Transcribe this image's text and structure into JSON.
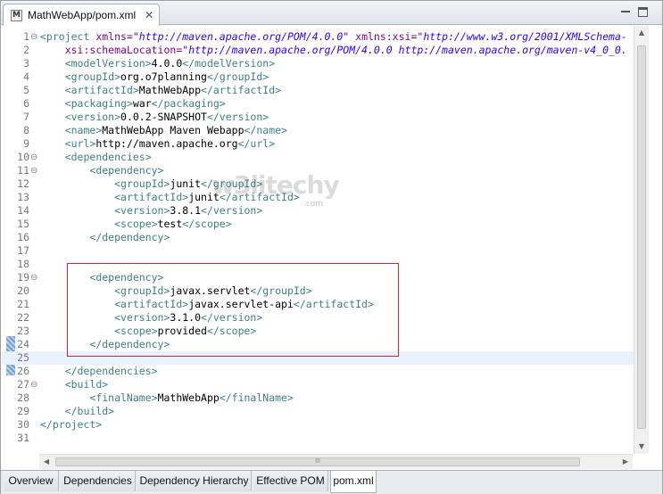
{
  "editor_tab": {
    "icon_letter": "M",
    "title": "MathWebApp/pom.xml",
    "close": "✕"
  },
  "lines": [
    {
      "n": "1",
      "fold": "⊖",
      "html": "<span class=\"t\">&lt;project</span> <span class=\"an\">xmlns=</span><span class=\"av\">\"http://maven.apache.org/POM/4.0.0\"</span> <span class=\"an\">xmlns:xsi=</span><span class=\"av\">\"http://www.w3.org/2001/XMLSchema-</span>"
    },
    {
      "n": "2",
      "html": "    <span class=\"an\">xsi:schemaLocation=</span><span class=\"av\">\"http://maven.apache.org/POM/4.0.0 http://maven.apache.org/maven-v4_0_0.</span>"
    },
    {
      "n": "3",
      "html": "    <span class=\"t\">&lt;modelVersion&gt;</span><span class=\"tx\">4.0.0</span><span class=\"t\">&lt;/modelVersion&gt;</span>"
    },
    {
      "n": "4",
      "html": "    <span class=\"t\">&lt;groupId&gt;</span><span class=\"tx\">org.o7planning</span><span class=\"t\">&lt;/groupId&gt;</span>"
    },
    {
      "n": "5",
      "html": "    <span class=\"t\">&lt;artifactId&gt;</span><span class=\"tx\">MathWebApp</span><span class=\"t\">&lt;/artifactId&gt;</span>"
    },
    {
      "n": "6",
      "html": "    <span class=\"t\">&lt;packaging&gt;</span><span class=\"tx\">war</span><span class=\"t\">&lt;/packaging&gt;</span>"
    },
    {
      "n": "7",
      "html": "    <span class=\"t\">&lt;version&gt;</span><span class=\"tx\">0.0.2-SNAPSHOT</span><span class=\"t\">&lt;/version&gt;</span>"
    },
    {
      "n": "8",
      "html": "    <span class=\"t\">&lt;name&gt;</span><span class=\"tx\">MathWebApp Maven Webapp</span><span class=\"t\">&lt;/name&gt;</span>"
    },
    {
      "n": "9",
      "html": "    <span class=\"t\">&lt;url&gt;</span><span class=\"tx\">http://maven.apache.org</span><span class=\"t\">&lt;/url&gt;</span>"
    },
    {
      "n": "10",
      "fold": "⊖",
      "html": "    <span class=\"t\">&lt;dependencies&gt;</span>"
    },
    {
      "n": "11",
      "fold": "⊖",
      "html": "        <span class=\"t\">&lt;dependency&gt;</span>"
    },
    {
      "n": "12",
      "html": "            <span class=\"t\">&lt;groupId&gt;</span><span class=\"tx\">junit</span><span class=\"t\">&lt;/groupId&gt;</span>"
    },
    {
      "n": "13",
      "html": "            <span class=\"t\">&lt;artifactId&gt;</span><span class=\"tx\">junit</span><span class=\"t\">&lt;/artifactId&gt;</span>"
    },
    {
      "n": "14",
      "html": "            <span class=\"t\">&lt;version&gt;</span><span class=\"tx\">3.8.1</span><span class=\"t\">&lt;/version&gt;</span>"
    },
    {
      "n": "15",
      "html": "            <span class=\"t\">&lt;scope&gt;</span><span class=\"tx\">test</span><span class=\"t\">&lt;/scope&gt;</span>"
    },
    {
      "n": "16",
      "html": "        <span class=\"t\">&lt;/dependency&gt;</span>"
    },
    {
      "n": "17",
      "html": ""
    },
    {
      "n": "18",
      "html": ""
    },
    {
      "n": "19",
      "fold": "⊖",
      "html": "        <span class=\"t\">&lt;dependency&gt;</span>"
    },
    {
      "n": "20",
      "html": "            <span class=\"t\">&lt;groupId&gt;</span><span class=\"tx\">javax.servlet</span><span class=\"t\">&lt;/groupId&gt;</span>"
    },
    {
      "n": "21",
      "html": "            <span class=\"t\">&lt;artifactId&gt;</span><span class=\"tx\">javax.servlet-api</span><span class=\"t\">&lt;/artifactId&gt;</span>"
    },
    {
      "n": "22",
      "html": "            <span class=\"t\">&lt;version&gt;</span><span class=\"tx\">3.1.0</span><span class=\"t\">&lt;/version&gt;</span>"
    },
    {
      "n": "23",
      "html": "            <span class=\"t\">&lt;scope&gt;</span><span class=\"tx\">provided</span><span class=\"t\">&lt;/scope&gt;</span>"
    },
    {
      "n": "24",
      "html": "        <span class=\"t\">&lt;/dependency&gt;</span>"
    },
    {
      "n": "25",
      "current": true,
      "html": ""
    },
    {
      "n": "26",
      "html": "    <span class=\"t\">&lt;/dependencies&gt;</span>"
    },
    {
      "n": "27",
      "fold": "⊖",
      "html": "    <span class=\"t\">&lt;build&gt;</span>"
    },
    {
      "n": "28",
      "html": "        <span class=\"t\">&lt;finalName&gt;</span><span class=\"tx\">MathWebApp</span><span class=\"t\">&lt;/finalName&gt;</span>"
    },
    {
      "n": "29",
      "html": "    <span class=\"t\">&lt;/build&gt;</span>"
    },
    {
      "n": "30",
      "html": "<span class=\"t\">&lt;/project&gt;</span>"
    },
    {
      "n": "31",
      "html": ""
    }
  ],
  "watermark": {
    "text": "w3litechy",
    "sub": ".com"
  },
  "scroll": {
    "up": "▲",
    "down": "▼",
    "left": "◀",
    "right": "▶",
    "grip": "III"
  },
  "page_tabs": [
    {
      "label": "Overview"
    },
    {
      "label": "Dependencies"
    },
    {
      "label": "Dependency Hierarchy"
    },
    {
      "label": "Effective POM"
    },
    {
      "label": "pom.xml",
      "active": true
    }
  ],
  "colors": {
    "tag": "#3f7f7f",
    "attr_name": "#7f007f",
    "attr_value": "#2a00ff",
    "highlight_border": "#d9232d",
    "current_line": "#e8f2fe"
  }
}
